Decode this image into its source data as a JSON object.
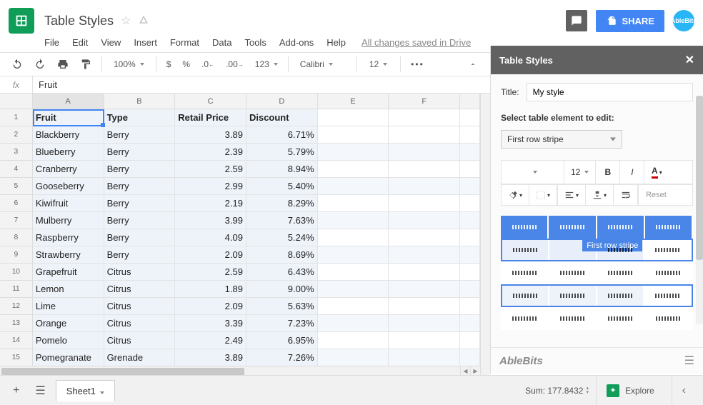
{
  "app": {
    "doc_title": "Table Styles",
    "saved": "All changes saved in Drive",
    "share": "SHARE",
    "avatar": "AbleBits"
  },
  "menu": [
    "File",
    "Edit",
    "View",
    "Insert",
    "Format",
    "Data",
    "Tools",
    "Add-ons",
    "Help"
  ],
  "toolbar": {
    "zoom": "100%",
    "currency": "$",
    "percent": "%",
    "dec_dec": ".0",
    "dec_inc": ".00",
    "num_fmt": "123",
    "font": "Calibri",
    "size": "12",
    "more": "•••"
  },
  "formula": {
    "fx": "fx",
    "value": "Fruit"
  },
  "columns": [
    "A",
    "B",
    "C",
    "D",
    "E",
    "F"
  ],
  "headers": [
    "Fruit",
    "Type",
    "Retail Price",
    "Discount"
  ],
  "rows": [
    {
      "n": 1,
      "cells": [
        "Fruit",
        "Type",
        "Retail Price",
        "Discount"
      ],
      "hdr": true
    },
    {
      "n": 2,
      "cells": [
        "Blackberry",
        "Berry",
        "3.89",
        "6.71%"
      ]
    },
    {
      "n": 3,
      "cells": [
        "Blueberry",
        "Berry",
        "2.39",
        "5.79%"
      ]
    },
    {
      "n": 4,
      "cells": [
        "Cranberry",
        "Berry",
        "2.59",
        "8.94%"
      ]
    },
    {
      "n": 5,
      "cells": [
        "Gooseberry",
        "Berry",
        "2.99",
        "5.40%"
      ]
    },
    {
      "n": 6,
      "cells": [
        "Kiwifruit",
        "Berry",
        "2.19",
        "8.29%"
      ]
    },
    {
      "n": 7,
      "cells": [
        "Mulberry",
        "Berry",
        "3.99",
        "7.63%"
      ]
    },
    {
      "n": 8,
      "cells": [
        "Raspberry",
        "Berry",
        "4.09",
        "5.24%"
      ]
    },
    {
      "n": 9,
      "cells": [
        "Strawberry",
        "Berry",
        "2.09",
        "8.69%"
      ]
    },
    {
      "n": 10,
      "cells": [
        "Grapefruit",
        "Citrus",
        "2.59",
        "6.43%"
      ]
    },
    {
      "n": 11,
      "cells": [
        "Lemon",
        "Citrus",
        "1.89",
        "9.00%"
      ]
    },
    {
      "n": 12,
      "cells": [
        "Lime",
        "Citrus",
        "2.09",
        "5.63%"
      ]
    },
    {
      "n": 13,
      "cells": [
        "Orange",
        "Citrus",
        "3.39",
        "7.23%"
      ]
    },
    {
      "n": 14,
      "cells": [
        "Pomelo",
        "Citrus",
        "2.49",
        "6.95%"
      ]
    },
    {
      "n": 15,
      "cells": [
        "Pomegranate",
        "Grenade",
        "3.89",
        "7.26%"
      ]
    }
  ],
  "sidebar": {
    "title": "Table Styles",
    "title_label": "Title:",
    "title_value": "My style",
    "section_label": "Select table element to edit:",
    "select_value": "First row stripe",
    "font_size": "12",
    "bold": "B",
    "italic": "I",
    "underline_a": "A",
    "reset": "Reset",
    "tooltip": "First row stripe",
    "brand": "AbleBits"
  },
  "bottom": {
    "sheet": "Sheet1",
    "sum": "Sum: 177.8432",
    "explore": "Explore"
  }
}
